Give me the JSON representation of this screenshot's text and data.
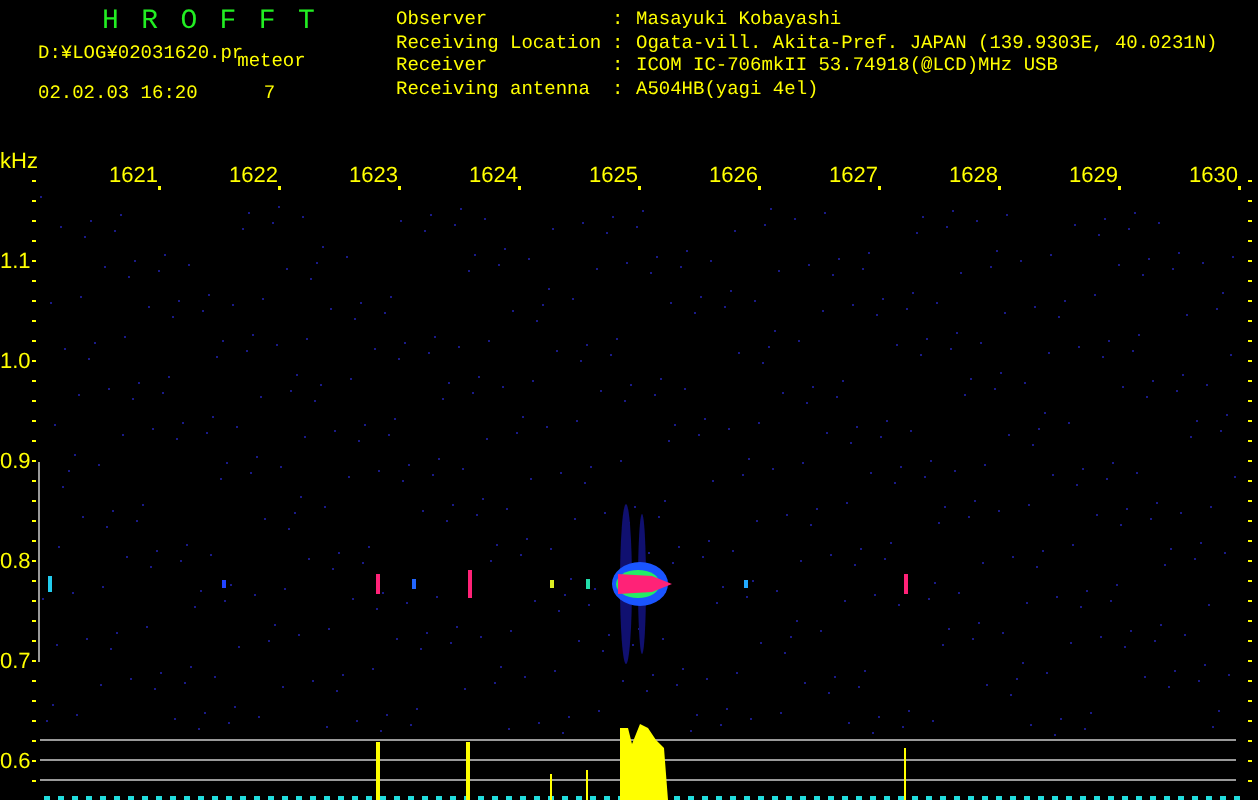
{
  "header": {
    "app_title": "H R O F F T",
    "file_path": "D:¥LOG¥02031620.pr",
    "mode": "meteor",
    "timestamp": "02.02.03 16:20",
    "count": "7"
  },
  "station_info": [
    {
      "label": "Observer",
      "separator": ":",
      "value": "Masayuki Kobayashi"
    },
    {
      "label": "Receiving Location",
      "separator": ":",
      "value": "Ogata-vill. Akita-Pref. JAPAN (139.9303E, 40.0231N)"
    },
    {
      "label": "Receiver",
      "separator": ":",
      "value": "ICOM IC-706mkII 53.74918(@LCD)MHz USB"
    },
    {
      "label": "Receiving antenna",
      "separator": ":",
      "value": "A504HB(yagi 4el)"
    }
  ],
  "spectrogram": {
    "time_labels": [
      "1621",
      "1622",
      "1623",
      "1624",
      "1625",
      "1626",
      "1627",
      "1628",
      "1629",
      "1630"
    ],
    "frequency_unit": "kHz",
    "frequency_labels": [
      "1.1",
      "1.0",
      "0.9",
      "0.8",
      "0.7",
      "0.6"
    ]
  }
}
